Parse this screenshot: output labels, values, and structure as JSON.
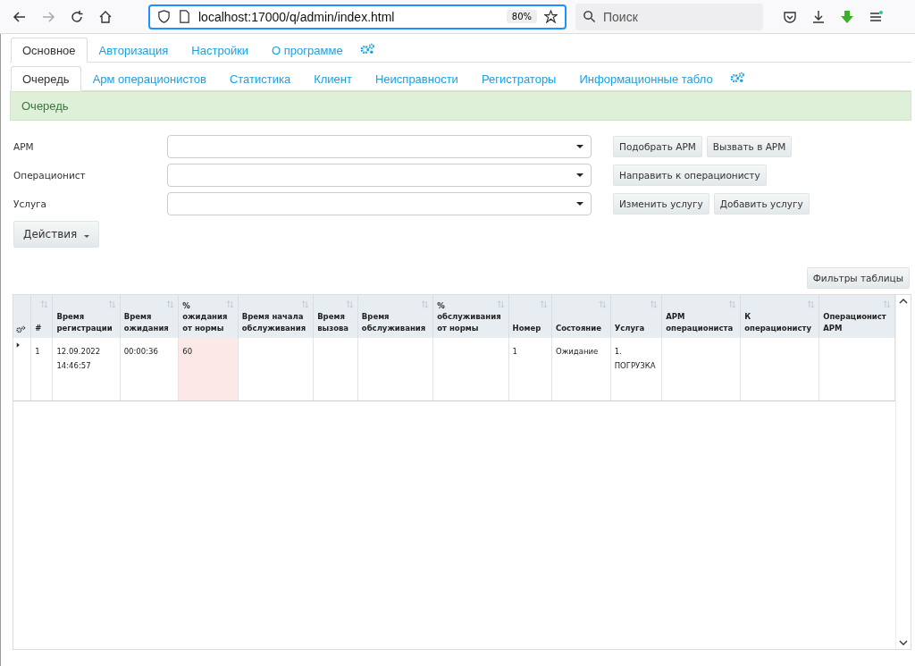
{
  "browser": {
    "url": "localhost:17000/q/admin/index.html",
    "zoom": "80%",
    "search_placeholder": "Поиск"
  },
  "main_tabs": [
    {
      "label": "Основное",
      "selected": true
    },
    {
      "label": "Авторизация",
      "selected": false
    },
    {
      "label": "Настройки",
      "selected": false
    },
    {
      "label": "О программе",
      "selected": false
    }
  ],
  "sub_tabs": [
    {
      "label": "Очередь",
      "selected": true
    },
    {
      "label": "Арм операционистов",
      "selected": false
    },
    {
      "label": "Статистика",
      "selected": false
    },
    {
      "label": "Клиент",
      "selected": false
    },
    {
      "label": "Неисправности",
      "selected": false
    },
    {
      "label": "Регистраторы",
      "selected": false
    },
    {
      "label": "Информационные табло",
      "selected": false
    }
  ],
  "panel_title": "Очередь",
  "form": [
    {
      "label": "АРМ",
      "buttons": [
        "Подобрать АРМ",
        "Вызвать в АРМ"
      ]
    },
    {
      "label": "Операционист",
      "buttons": [
        "Направить к операционисту"
      ]
    },
    {
      "label": "Услуга",
      "buttons": [
        "Изменить услугу",
        "Добавить услугу"
      ]
    }
  ],
  "actions_button": "Действия",
  "filters_button": "Фильтры таблицы",
  "table": {
    "columns": [
      "#",
      "Время регистрации",
      "Время ожидания",
      "% ожидания от нормы",
      "Время начала обслуживания",
      "Время вызова",
      "Время обслуживания",
      "% обслуживания от нормы",
      "Номер",
      "Состояние",
      "Услуга",
      "АРМ операциониста",
      "К операционисту",
      "Операционист АРМ"
    ],
    "rows": [
      {
        "expanded": false,
        "cells": [
          {
            "text": "1"
          },
          {
            "text": "12.09.2022 14:46:57"
          },
          {
            "text": "00:00:36"
          },
          {
            "text": "60",
            "warning": true
          },
          {},
          {},
          {},
          {},
          {
            "text": "1"
          },
          {
            "text": "Ожидание"
          },
          {
            "text": "1. ПОГРУЗКА"
          },
          {},
          {},
          {}
        ]
      }
    ]
  }
}
